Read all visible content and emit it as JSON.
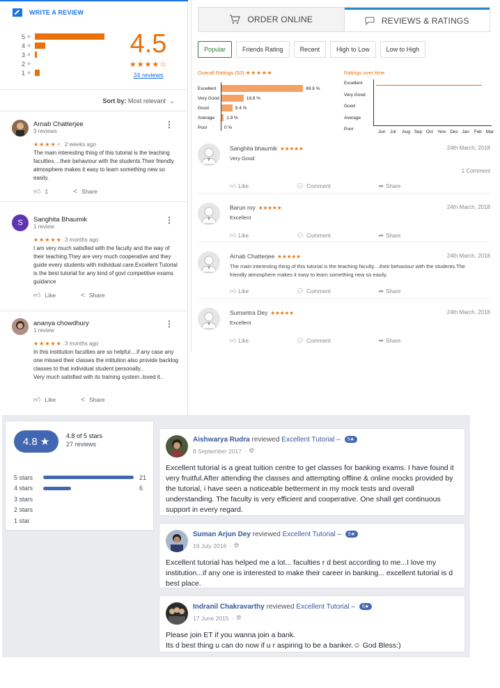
{
  "google": {
    "write_review": "WRITE A REVIEW",
    "score": "4.5",
    "score_stars": "★★★★☆",
    "review_count": "34 reviews",
    "distribution": [
      {
        "stars": "5",
        "fraction": 1.0
      },
      {
        "stars": "4",
        "fraction": 0.15
      },
      {
        "stars": "3",
        "fraction": 0.03
      },
      {
        "stars": "2",
        "fraction": 0.0
      },
      {
        "stars": "1",
        "fraction": 0.07
      }
    ],
    "sort_label": "Sort by:",
    "sort_value": "Most relevant",
    "reviews": [
      {
        "name": "Arnab Chatterjee",
        "sub": "3 reviews",
        "stars": "★★★★",
        "stars_empty": "★",
        "when": "2 weeks ago",
        "text": "The main interesting thing of this tutorial is the teaching faculties....their behaviour with the students.Their friendly atmosphere makes it easy to learn something new so easily.",
        "likes": "1",
        "like_label": "",
        "share": "Share"
      },
      {
        "name": "Sanghita Bhaumik",
        "sub": "1 review",
        "stars": "★★★★★",
        "stars_empty": "",
        "when": "3 months ago",
        "text": "I am very much satisfied with the faculty and the way of their teaching.They are very much cooperative and they guide every students with individual care.Excellent Tutorial is the best tutorial for any kind of govt competitive exams guidance",
        "likes": "",
        "like_label": "Like",
        "share": "Share",
        "initial": "S"
      },
      {
        "name": "ananya chowdhury",
        "sub": "1 review",
        "stars": "★★★★★",
        "stars_empty": "",
        "when": "3 months ago",
        "text": "In this institution faculties are so helpful....if any case any one missed their classes the intitution also provide backlog classes to that individual student personally..\nVery much satisfied with its training system..loved it..",
        "likes": "",
        "like_label": "Like",
        "share": "Share"
      }
    ]
  },
  "zomato": {
    "tabs": [
      {
        "label": "ORDER ONLINE",
        "icon": "cart-icon"
      },
      {
        "label": "REVIEWS & RATINGS",
        "icon": "chat-icon"
      }
    ],
    "filters": [
      "Popular",
      "Friends Rating",
      "Recent",
      "High to Low",
      "Low to High"
    ],
    "overall_title": "Overall Ratings (53)",
    "overall_stars": "★★★★★",
    "overall": [
      {
        "label": "Excellent",
        "pct": "69.8 %",
        "value": 69.8
      },
      {
        "label": "Very Good",
        "pct": "18.9 %",
        "value": 18.9
      },
      {
        "label": "Good",
        "pct": "9.4 %",
        "value": 9.4
      },
      {
        "label": "Average",
        "pct": "1.9 %",
        "value": 1.9
      },
      {
        "label": "Poor",
        "pct": "0 %",
        "value": 0
      }
    ],
    "time_title": "Ratings over time",
    "time_levels": [
      "Excellent",
      "Very Good",
      "Good",
      "Average",
      "Poor"
    ],
    "months": [
      "Jun",
      "Jul",
      "Aug",
      "Sep",
      "Oct",
      "Nov",
      "Dec",
      "Jan",
      "Feb",
      "Mar"
    ],
    "reviews": [
      {
        "name": "Sanghita bhaumik",
        "stars": "★★★★★",
        "date": "24th March, 2018",
        "text": "Very Good",
        "comment": "1 Comment"
      },
      {
        "name": "Barun roy",
        "stars": "★★★★★",
        "date": "24th March, 2018",
        "text": "Excellent",
        "comment": ""
      },
      {
        "name": "Arnab Chatterjee",
        "stars": "★★★★★",
        "date": "24th March, 2018",
        "text": "The main interesting thing of this tutorial is the teaching faculty....their behaviour with the students.The friendly atmosphere makes it easy to learn something new so easily.",
        "comment": ""
      },
      {
        "name": "Sumantra Dey",
        "stars": "★★★★★",
        "date": "24th March, 2018",
        "text": "Excellent",
        "comment": ""
      }
    ],
    "like": "Like",
    "comment_label": "Comment",
    "share": "Share"
  },
  "facebook": {
    "score": "4.8",
    "star": "★",
    "of_stars": "4.8 of 5 stars",
    "review_count": "27 reviews",
    "bars": [
      {
        "label": "5 stars",
        "count": "21",
        "fraction": 1.0
      },
      {
        "label": "4 stars",
        "count": "6",
        "fraction": 0.31
      },
      {
        "label": "3 stars",
        "count": "",
        "fraction": 0
      },
      {
        "label": "2 stars",
        "count": "",
        "fraction": 0
      },
      {
        "label": "1 star",
        "count": "",
        "fraction": 0
      }
    ],
    "posts": [
      {
        "name": "Aishwarya Rudra",
        "verb": "reviewed",
        "page": "Excellent Tutorial",
        "badge": "5★",
        "date": "8 September 2017",
        "text": "Excellent tutorial is a great tuition centre to get classes for banking exams. I have found it very fruitful.After attending the classes and attempting offline & online mocks provided by the tutorial, i have seen a noticeable betterment in my mock tests and overall understanding. The faculty is very efficient and cooperative. One shall get continuous support in every regard."
      },
      {
        "name": "Suman Arjun Dey",
        "verb": "reviewed",
        "page": "Excellent Tutorial",
        "badge": "5★",
        "date": "19 July 2016",
        "text": "Excellent tutorial has helped me a lot... faculties r d best according to me...I love my institution...if any one is interested to make their career in banking... excellent tutorial is d best place."
      },
      {
        "name": "Indranil Chakravarthy",
        "verb": "reviewed",
        "page": "Excellent Tutorial",
        "badge": "5★",
        "date": "17 June 2015",
        "text": "Please join ET if you wanna join a bank.\nIts d best thing u can do now if u r aspiring to be a banker.☺ God Bless:)"
      }
    ]
  }
}
